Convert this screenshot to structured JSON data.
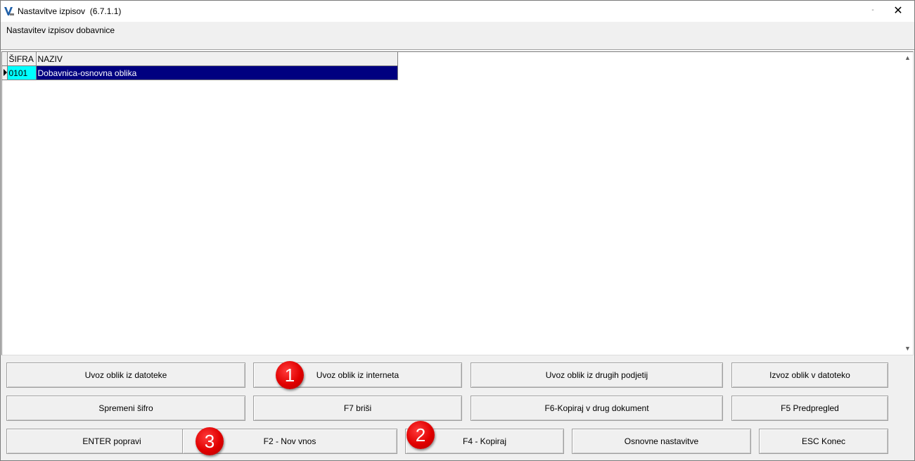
{
  "window": {
    "title": "Nastavitve izpisov  (6.7.1.1)",
    "minimize_glyph": "-",
    "close_glyph": "✕",
    "icon": "app-logo-icon"
  },
  "subtitle": "Nastavitev izpisov dobavnice",
  "grid": {
    "columns": [
      "ŠIFRA",
      "NAZIV"
    ],
    "rows": [
      {
        "code": "0101",
        "name": "Dobavnica-osnovna oblika",
        "selected": true
      }
    ]
  },
  "scrollbar": {
    "up_glyph": "▲",
    "down_glyph": "▼"
  },
  "buttons": {
    "import_file": "Uvoz oblik iz datoteke",
    "import_internet": "Uvoz oblik iz interneta",
    "import_companies": "Uvoz oblik iz drugih podjetij",
    "export_file": "Izvoz oblik v datoteko",
    "change_code": "Spremeni šifro",
    "delete": "F7 briši",
    "copy_doc": "F6-Kopiraj v drug dokument",
    "preview": "F5 Predpregled",
    "edit": "ENTER popravi",
    "new_entry": "F2 - Nov vnos",
    "copy": "F4 - Kopiraj",
    "basic_settings": "Osnovne nastavitve",
    "close": "ESC Konec"
  },
  "badges": {
    "one": "1",
    "two": "2",
    "three": "3"
  },
  "colors": {
    "selection": "#000080",
    "code_highlight": "#00ffff",
    "badge": "#e00000",
    "window_bg": "#f0f0f0"
  }
}
